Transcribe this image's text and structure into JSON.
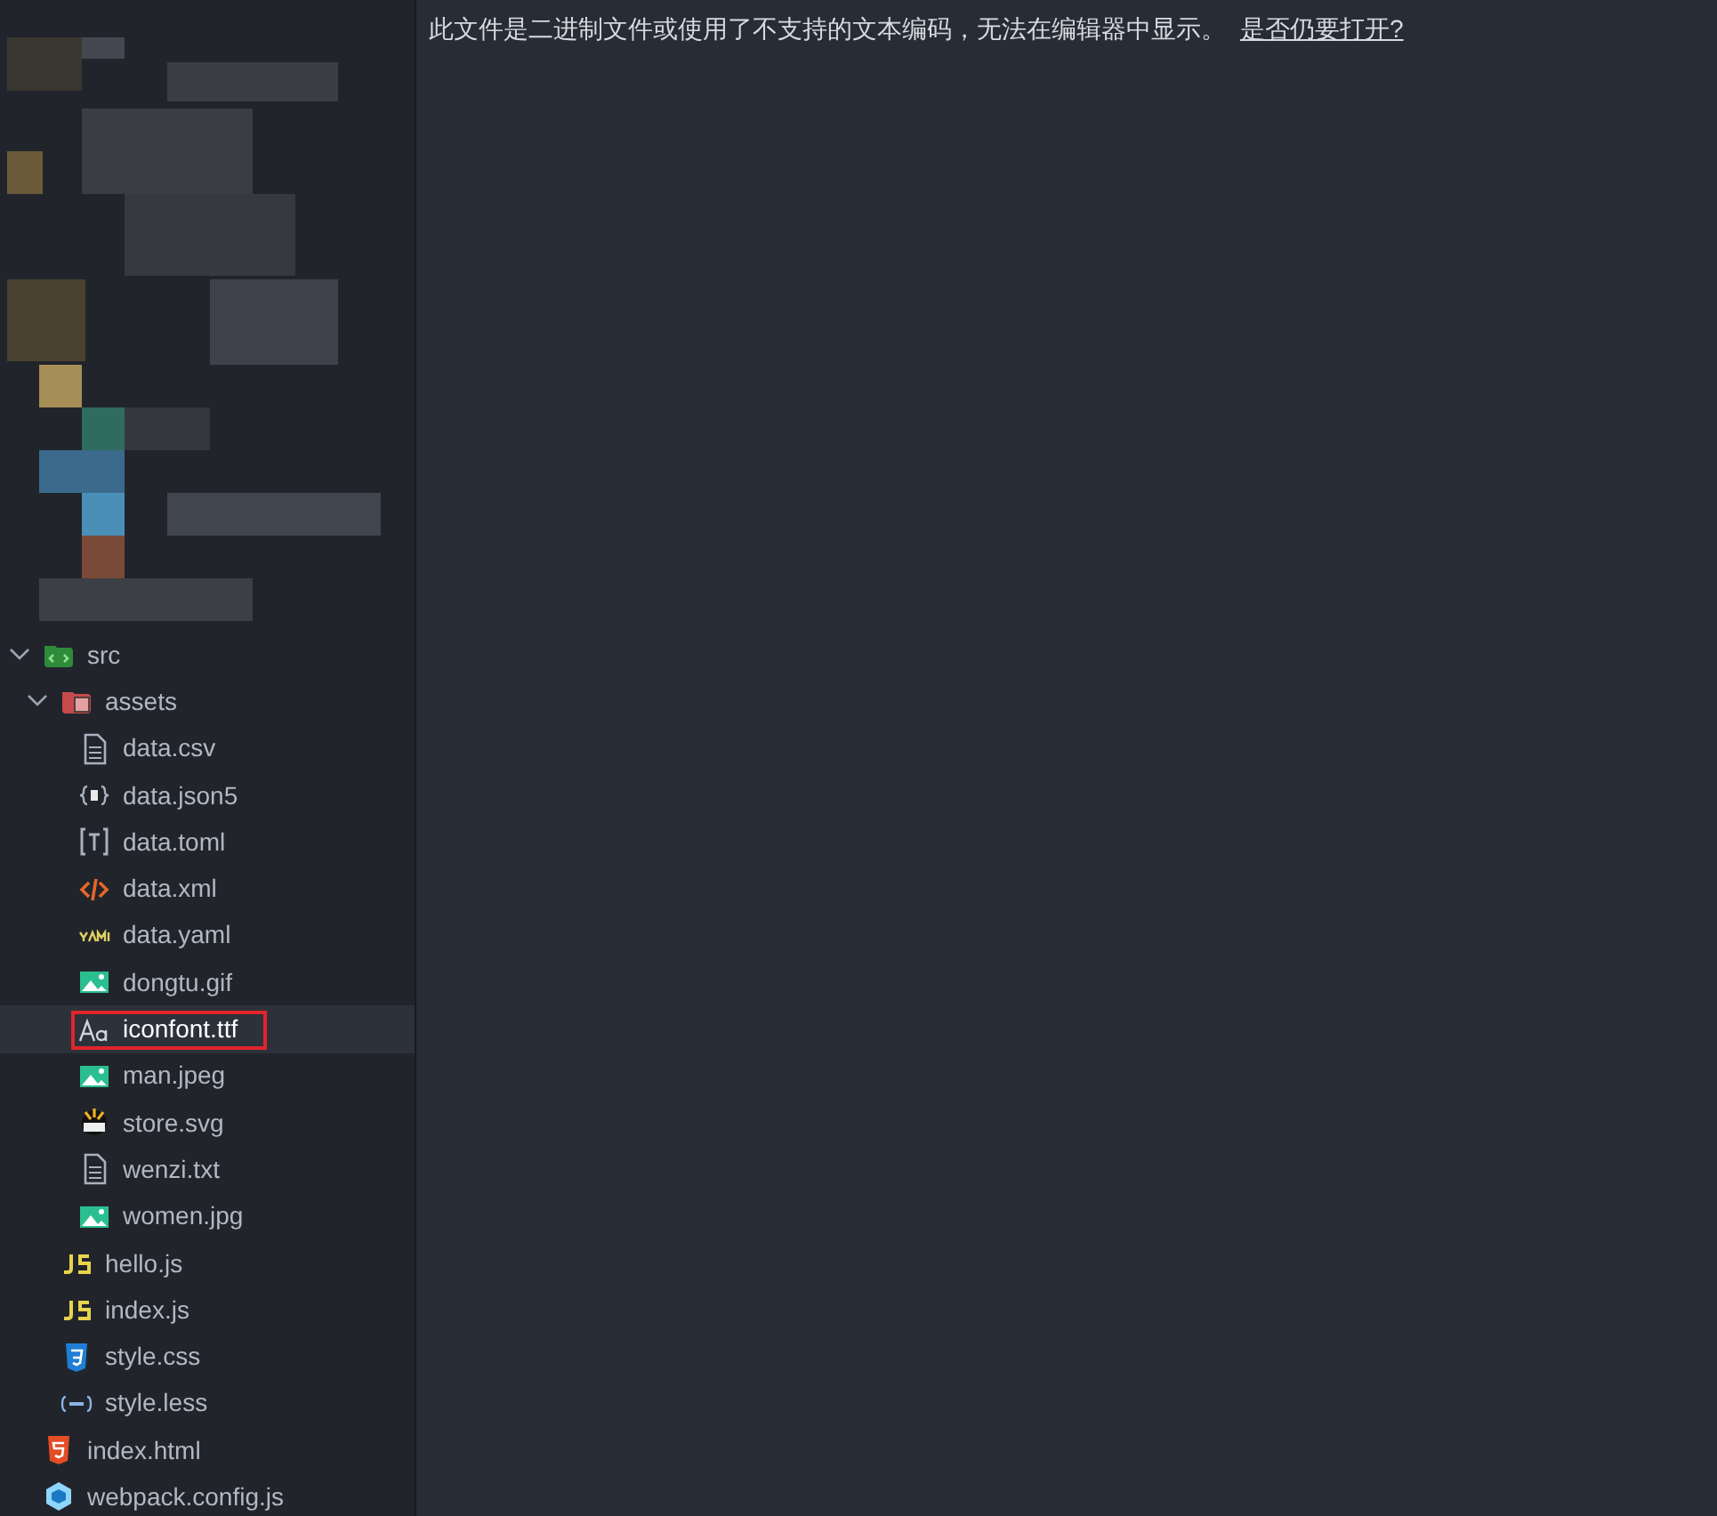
{
  "sidebar": {
    "tree": [
      {
        "label": "src",
        "kind": "folder-src",
        "expanded": true,
        "selected": false,
        "marked": false,
        "children": [
          {
            "label": "assets",
            "kind": "folder-assets",
            "expanded": true,
            "selected": false,
            "marked": false,
            "children": [
              {
                "label": "data.csv",
                "kind": "doc",
                "selected": false,
                "marked": false
              },
              {
                "label": "data.json5",
                "kind": "json5",
                "selected": false,
                "marked": false
              },
              {
                "label": "data.toml",
                "kind": "toml",
                "selected": false,
                "marked": false
              },
              {
                "label": "data.xml",
                "kind": "xml",
                "selected": false,
                "marked": false
              },
              {
                "label": "data.yaml",
                "kind": "yaml",
                "selected": false,
                "marked": false
              },
              {
                "label": "dongtu.gif",
                "kind": "image",
                "selected": false,
                "marked": false
              },
              {
                "label": "iconfont.ttf",
                "kind": "font",
                "selected": true,
                "marked": true
              },
              {
                "label": "man.jpeg",
                "kind": "image",
                "selected": false,
                "marked": false
              },
              {
                "label": "store.svg",
                "kind": "svg",
                "selected": false,
                "marked": false
              },
              {
                "label": "wenzi.txt",
                "kind": "doc",
                "selected": false,
                "marked": false
              },
              {
                "label": "women.jpg",
                "kind": "image",
                "selected": false,
                "marked": false
              }
            ]
          },
          {
            "label": "hello.js",
            "kind": "js",
            "selected": false,
            "marked": false
          },
          {
            "label": "index.js",
            "kind": "js",
            "selected": false,
            "marked": false
          },
          {
            "label": "style.css",
            "kind": "css",
            "selected": false,
            "marked": false
          },
          {
            "label": "style.less",
            "kind": "less",
            "selected": false,
            "marked": false
          }
        ]
      },
      {
        "label": "index.html",
        "kind": "html",
        "selected": false,
        "marked": false
      },
      {
        "label": "webpack.config.js",
        "kind": "webpack",
        "selected": false,
        "marked": false
      }
    ]
  },
  "editor": {
    "message": "此文件是二进制文件或使用了不支持的文本编码，无法在编辑器中显示。",
    "link": "是否仍要打开?"
  }
}
